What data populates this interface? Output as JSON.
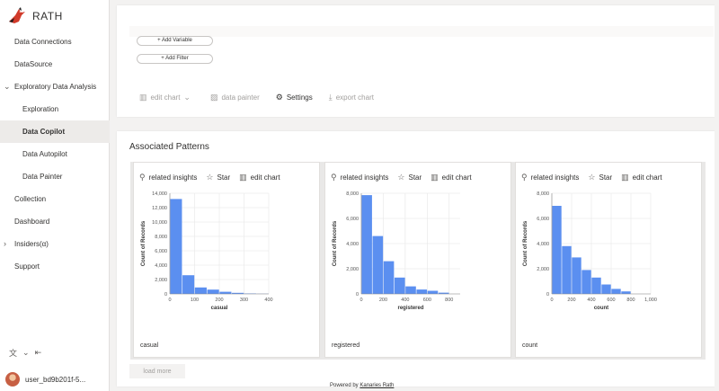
{
  "app": {
    "name": "RATH"
  },
  "sidebar": {
    "items": [
      {
        "label": "Data Connections"
      },
      {
        "label": "DataSource"
      },
      {
        "label": "Exploratory Data Analysis"
      },
      {
        "label": "Exploration"
      },
      {
        "label": "Data Copilot"
      },
      {
        "label": "Data Autopilot"
      },
      {
        "label": "Data Painter"
      },
      {
        "label": "Collection"
      },
      {
        "label": "Dashboard"
      },
      {
        "label": "Insiders(α)"
      },
      {
        "label": "Support"
      }
    ],
    "user": "user_bd9b201f-5..."
  },
  "controls": {
    "add_variable": "+ Add Variable",
    "add_filter": "+ Add Filter"
  },
  "toolbar": {
    "edit_chart": "edit chart",
    "data_painter": "data painter",
    "settings": "Settings",
    "export_chart": "export chart"
  },
  "patterns": {
    "title": "Associated Patterns",
    "actions": {
      "related": "related insights",
      "star": "Star",
      "edit": "edit chart"
    },
    "load_more": "load more"
  },
  "footer": {
    "prefix": "Powered by",
    "link": "Kanaries Rath"
  },
  "colors": {
    "bar": "#5b8ff0",
    "accent": "#0078d4"
  },
  "chart_data": [
    {
      "type": "bar",
      "field": "casual",
      "xlabel": "casual",
      "ylabel": "Count of Records",
      "xlim": [
        0,
        400
      ],
      "ylim": [
        0,
        14000
      ],
      "yticks": [
        0,
        2000,
        4000,
        6000,
        8000,
        10000,
        12000,
        14000
      ],
      "xticks": [
        0,
        100,
        200,
        300,
        400
      ],
      "bin_width": 50,
      "values": [
        13200,
        2600,
        900,
        600,
        300,
        150,
        60,
        20
      ]
    },
    {
      "type": "bar",
      "field": "registered",
      "xlabel": "registered",
      "ylabel": "Count of Records",
      "xlim": [
        0,
        900
      ],
      "ylim": [
        0,
        8000
      ],
      "yticks": [
        0,
        2000,
        4000,
        6000,
        8000
      ],
      "xticks": [
        0,
        200,
        400,
        600,
        800
      ],
      "bin_width": 100,
      "values": [
        7850,
        4600,
        2600,
        1300,
        600,
        350,
        250,
        100
      ]
    },
    {
      "type": "bar",
      "field": "count",
      "xlabel": "count",
      "ylabel": "Count of Records",
      "xlim": [
        0,
        1000
      ],
      "ylim": [
        0,
        8000
      ],
      "yticks": [
        0,
        2000,
        4000,
        6000,
        8000
      ],
      "xticks": [
        0,
        200,
        400,
        600,
        800,
        1000
      ],
      "bin_width": 100,
      "values": [
        7000,
        3800,
        2900,
        1900,
        1300,
        750,
        400,
        200
      ]
    }
  ]
}
